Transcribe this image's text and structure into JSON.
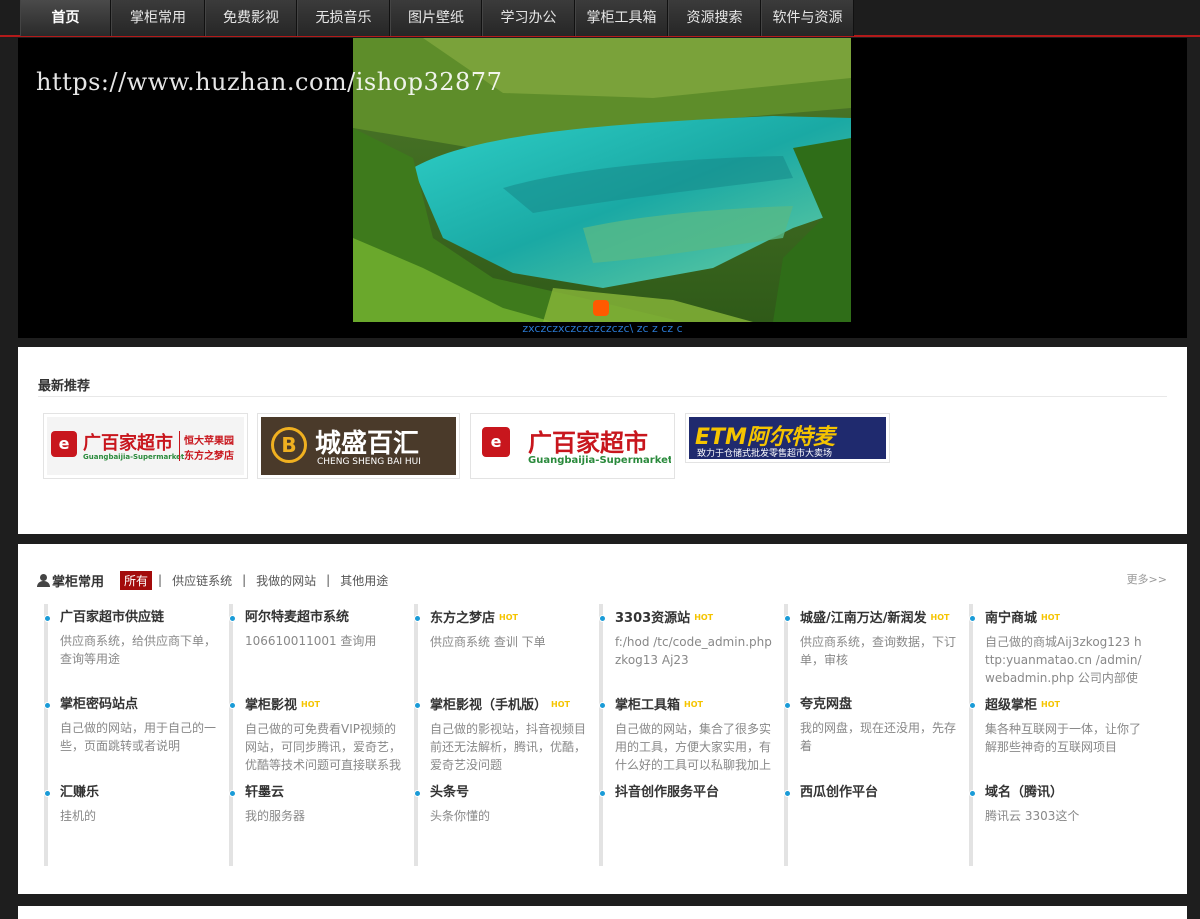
{
  "nav": {
    "items": [
      {
        "label": "首页",
        "active": true
      },
      {
        "label": "掌柜常用"
      },
      {
        "label": "免费影视"
      },
      {
        "label": "无损音乐"
      },
      {
        "label": "图片壁纸"
      },
      {
        "label": "学习办公"
      },
      {
        "label": "掌柜工具箱"
      },
      {
        "label": "资源搜索"
      },
      {
        "label": "软件与资源"
      }
    ]
  },
  "banner": {
    "watermark": "https://www.huzhan.com/ishop32877",
    "caption": "zxczczxczczczczczc\\ zc z cz c",
    "dot_color": "#ff5a00"
  },
  "latest": {
    "title": "最新推荐",
    "logos": [
      {
        "name": "广百家超市",
        "sub": "Guangbaijia-Supermarket",
        "tag1": "恒大苹果园",
        "tag2": "东方之梦店"
      },
      {
        "name": "城盛百汇",
        "sub": "CHENG SHENG BAI HUI"
      },
      {
        "name": "广百家超市",
        "sub": "Guangbaijia-Supermarket"
      },
      {
        "name": "ETM阿尔特麦",
        "sub": "致力于仓储式批发零售超市大卖场"
      }
    ]
  },
  "common": {
    "title": "掌柜常用",
    "tabs": [
      {
        "label": "所有",
        "active": true
      },
      {
        "label": "供应链系统"
      },
      {
        "label": "我做的网站"
      },
      {
        "label": "其他用途"
      }
    ],
    "more": "更多>>",
    "hot_label": "HOT",
    "items": [
      {
        "title": "广百家超市供应链",
        "hot": false,
        "desc": "供应商系统，给供应商下单，查询等用途"
      },
      {
        "title": "阿尔特麦超市系统",
        "hot": false,
        "desc": "106610011001 查询用"
      },
      {
        "title": "东方之梦店",
        "hot": true,
        "desc": "供应商系统 查训 下单"
      },
      {
        "title": "3303资源站",
        "hot": true,
        "desc": "f:/hod /tc/code_admin.php zkog13 Aj23"
      },
      {
        "title": "城盛/江南万达/新润发",
        "hot": true,
        "desc": "供应商系统，查询数据，下订单，审核"
      },
      {
        "title": "南宁商城",
        "hot": true,
        "desc": "自己做的商城Aij3zkog123 http:yuanmatao.cn /admin/webadmin.php 公司内部使用"
      },
      {
        "title": "掌柜密码站点",
        "hot": false,
        "desc": "自己做的网站，用于自己的一些，页面跳转或者说明"
      },
      {
        "title": "掌柜影视",
        "hot": true,
        "desc": "自己做的可免费看VIP视频的网站，可同步腾讯，爱奇艺，优酷等技术问题可直接联系我"
      },
      {
        "title": "掌柜影视（手机版）",
        "hot": true,
        "desc": "自己做的影视站，抖音视频目前还无法解析，腾讯，优酷，爱奇艺没问题"
      },
      {
        "title": "掌柜工具箱",
        "hot": true,
        "desc": "自己做的网站，集合了很多实用的工具，方便大家实用，有什么好的工具可以私聊我加上"
      },
      {
        "title": "夸克网盘",
        "hot": false,
        "desc": "我的网盘，现在还没用，先存着"
      },
      {
        "title": "超级掌柜",
        "hot": true,
        "desc": "集各种互联网于一体，让你了解那些神奇的互联网项目"
      },
      {
        "title": "汇赚乐",
        "hot": false,
        "desc": "挂机的"
      },
      {
        "title": "轩墨云",
        "hot": false,
        "desc": "我的服务器"
      },
      {
        "title": "头条号",
        "hot": false,
        "desc": "头条你懂的"
      },
      {
        "title": "抖音创作服务平台",
        "hot": false,
        "desc": ""
      },
      {
        "title": "西瓜创作平台",
        "hot": false,
        "desc": ""
      },
      {
        "title": "域名（腾讯）",
        "hot": false,
        "desc": "腾讯云 3303这个"
      }
    ]
  }
}
